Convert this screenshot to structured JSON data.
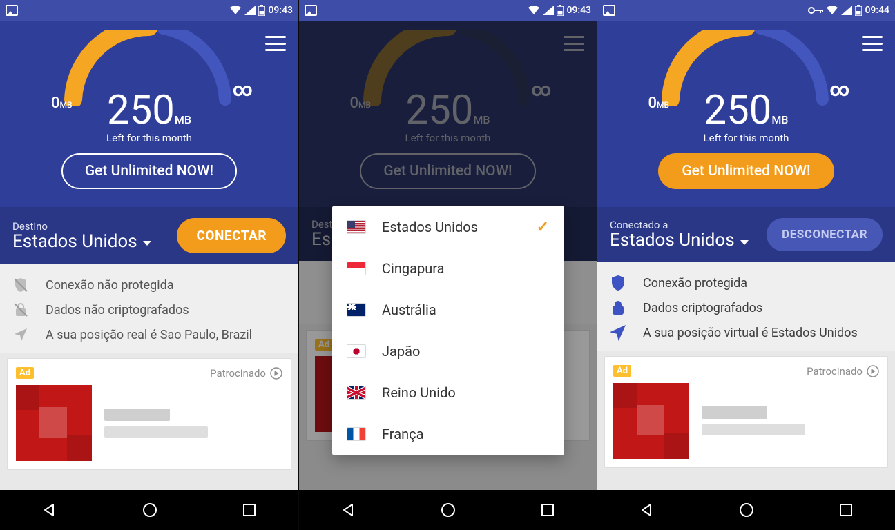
{
  "screens": [
    {
      "statusbar": {
        "time": "09:43",
        "has_key": false
      },
      "gauge": {
        "zero": "0",
        "zero_unit": "MB",
        "amount": "250",
        "unit": "MB",
        "subtitle": "Left for this month",
        "infinity": "∞"
      },
      "cta": "Get Unlimited NOW!",
      "dest_eyebrow": "Destino",
      "dest_name": "Estados Unidos",
      "action_label": "CONECTAR",
      "status_rows": [
        "Conexão não protegida",
        "Dados não criptografados",
        "A sua posição real é Sao Paulo, Brazil"
      ],
      "ad": {
        "badge": "Ad",
        "sponsored": "Patrocinado"
      }
    },
    {
      "statusbar": {
        "time": "09:43",
        "has_key": false
      },
      "gauge": {
        "zero": "0",
        "zero_unit": "MB",
        "amount": "250",
        "unit": "MB",
        "subtitle": "Left for this month",
        "infinity": "∞"
      },
      "cta": "Get Unlimited NOW!",
      "dest_eyebrow": "Destino",
      "dest_name": "Es",
      "popup": [
        {
          "flag": "us",
          "label": "Estados Unidos",
          "selected": true
        },
        {
          "flag": "sg",
          "label": "Cingapura"
        },
        {
          "flag": "au",
          "label": "Austrália"
        },
        {
          "flag": "jp",
          "label": "Japão"
        },
        {
          "flag": "uk",
          "label": "Reino Unido"
        },
        {
          "flag": "fr",
          "label": "França"
        }
      ]
    },
    {
      "statusbar": {
        "time": "09:44",
        "has_key": true
      },
      "gauge": {
        "zero": "0",
        "zero_unit": "MB",
        "amount": "250",
        "unit": "MB",
        "subtitle": "Left for this month",
        "infinity": "∞"
      },
      "cta": "Get Unlimited NOW!",
      "dest_eyebrow": "Conectado a",
      "dest_name": "Estados Unidos",
      "action_label": "DESCONECTAR",
      "status_rows": [
        "Conexão protegida",
        "Dados criptografados",
        "A sua posição virtual é Estados Unidos"
      ],
      "ad": {
        "badge": "Ad",
        "sponsored": "Patrocinado"
      }
    }
  ]
}
